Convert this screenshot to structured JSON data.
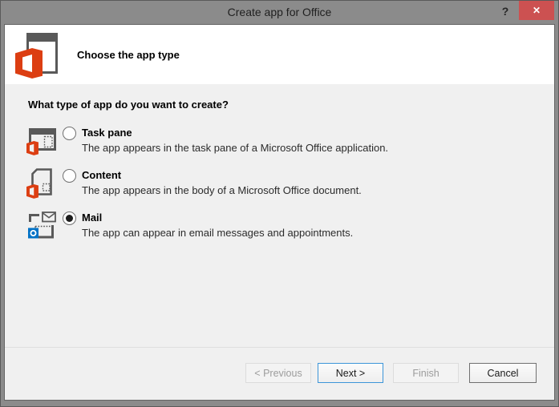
{
  "window": {
    "title": "Create app for Office",
    "icons": {
      "help": "?",
      "close": "✕"
    }
  },
  "header": {
    "title": "Choose the app type",
    "logo": "office-logo"
  },
  "main": {
    "question": "What type of app do you want to create?",
    "options": [
      {
        "icon": "task-pane-app-icon",
        "label": "Task pane",
        "description": "The app appears in the task pane of a Microsoft Office application.",
        "selected": false
      },
      {
        "icon": "content-app-icon",
        "label": "Content",
        "description": "The app appears in the body of a Microsoft Office document.",
        "selected": false
      },
      {
        "icon": "mail-app-icon",
        "label": "Mail",
        "description": "The app can appear in email messages and appointments.",
        "selected": true
      }
    ]
  },
  "footer": {
    "buttons": [
      {
        "label": "< Previous",
        "enabled": false,
        "default": false
      },
      {
        "label": "Next >",
        "enabled": true,
        "default": true
      },
      {
        "label": "Finish",
        "enabled": false,
        "default": false
      },
      {
        "label": "Cancel",
        "enabled": true,
        "default": false
      }
    ]
  },
  "colors": {
    "titlebar": "#8B8B8B",
    "close_button": "#CC5151",
    "office_orange": "#DC3E12",
    "outlook_blue": "#0072C6",
    "icon_gray": "#595959",
    "banner_bg": "#FFFFFF",
    "content_bg": "#F0F0F0",
    "default_button_border": "#3C95D9"
  }
}
